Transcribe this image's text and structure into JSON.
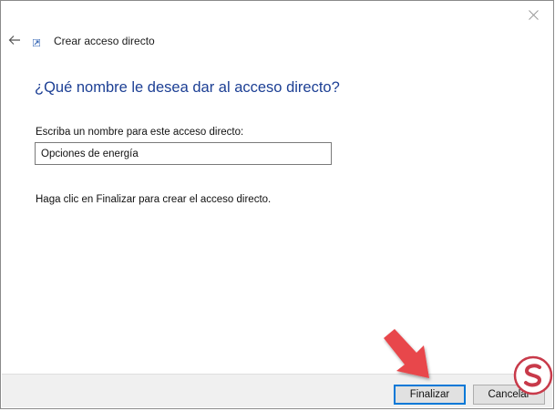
{
  "wizard": {
    "title": "Crear acceso directo",
    "heading": "¿Qué nombre le desea dar al acceso directo?",
    "name_label": "Escriba un nombre para este acceso directo:",
    "name_value": "Opciones de energía",
    "instruction": "Haga clic en Finalizar para crear el acceso directo."
  },
  "buttons": {
    "finish": "Finalizar",
    "cancel": "Cancelar"
  },
  "icons": {
    "close": "close-icon",
    "back": "back-arrow-icon",
    "shortcut": "shortcut-icon"
  },
  "colors": {
    "heading": "#1c3f94",
    "annotation_arrow": "#e8474c",
    "accent": "#0078d7"
  }
}
